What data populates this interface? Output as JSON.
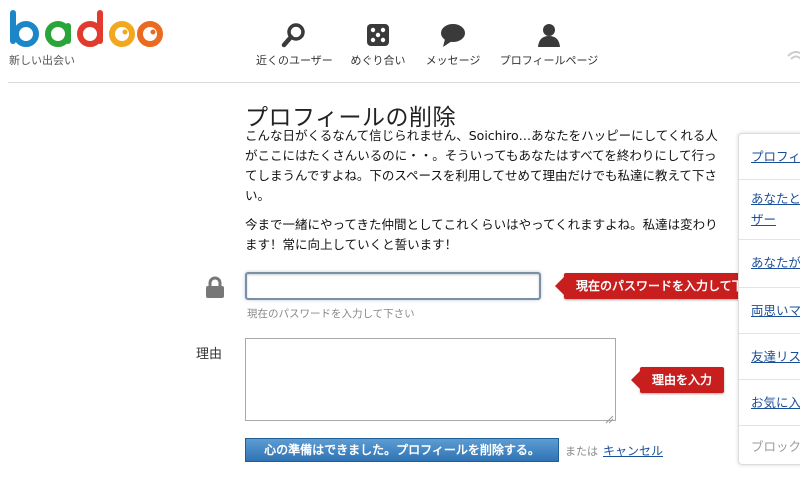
{
  "header": {
    "logo_text": "badoo",
    "tagline": "新しい出会い",
    "nav": [
      {
        "label": "近くのユーザー",
        "icon": "search-icon"
      },
      {
        "label": "めぐり合い",
        "icon": "dice-icon"
      },
      {
        "label": "メッセージ",
        "icon": "speech-bubble-icon"
      },
      {
        "label": "プロフィールページ",
        "icon": "user-icon"
      }
    ],
    "colors": {
      "b": "#1b86c8",
      "a": "#2aa53a",
      "d": "#e23a2e",
      "o1": "#f2a81e",
      "o2": "#ea6a1f",
      "accent": "#2f73b4"
    }
  },
  "main": {
    "title": "プロフィールの削除",
    "paragraph1": "こんな日がくるなんて信じられません、Soichiro…あなたをハッピーにしてくれる人がここにはたくさんいるのに・・。そういってもあなたはすべてを終わりにして行ってしまうんですよね。下のスペースを利用してせめて理由だけでも私達に教えて下さい。",
    "paragraph2": "今まで一緒にやってきた仲間としてこれくらいはやってくれますよね。私達は変わります！常に向上していくと誓います！",
    "password": {
      "value": "",
      "hint": "現在のパスワードを入力して下さい",
      "callout": "現在のパスワードを入力して下さい",
      "icon": "lock-icon"
    },
    "reason": {
      "label": "理由",
      "value": "",
      "callout": "理由を入力"
    },
    "delete_button": "心の準備はできました。プロフィールを削除する。",
    "or_text": "または",
    "cancel_link": "キャンセル"
  },
  "sidebar": {
    "items": [
      {
        "label": "プロフィ"
      },
      {
        "label": "あなたと",
        "label2": "ザー"
      },
      {
        "label": "あなたが"
      },
      {
        "label": "両思いマ"
      },
      {
        "label": "友達リス"
      },
      {
        "label": "お気に入"
      },
      {
        "label": "ブロック"
      }
    ]
  }
}
